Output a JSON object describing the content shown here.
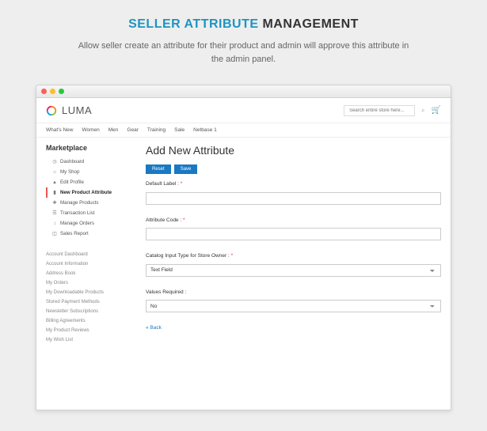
{
  "hero": {
    "title_accent": "SELLER ATTRIBUTE",
    "title_rest": "MANAGEMENT",
    "subtitle": "Allow seller create an attribute for their product and admin will approve this attribute in the admin panel."
  },
  "logo": {
    "text": "LUMA"
  },
  "search": {
    "placeholder": "Search entire store here..."
  },
  "mainnav": [
    "What's New",
    "Women",
    "Men",
    "Gear",
    "Training",
    "Sale",
    "Netbase 1"
  ],
  "sidebar": {
    "title": "Marketplace",
    "items": [
      {
        "icon": "dashboard-icon",
        "glyph": "◷",
        "label": "Dashboard"
      },
      {
        "icon": "home-icon",
        "glyph": "⌂",
        "label": "My Shop"
      },
      {
        "icon": "user-icon",
        "glyph": "▲",
        "label": "Edit Profile"
      },
      {
        "icon": "attribute-icon",
        "glyph": "▮",
        "label": "New Product Attribute",
        "active": true
      },
      {
        "icon": "products-icon",
        "glyph": "✚",
        "label": "Manage Products"
      },
      {
        "icon": "list-icon",
        "glyph": "☰",
        "label": "Transaction List"
      },
      {
        "icon": "orders-icon",
        "glyph": "↕",
        "label": "Manage Orders"
      },
      {
        "icon": "report-icon",
        "glyph": "◫",
        "label": "Sales Report"
      }
    ],
    "account_items": [
      "Account Dashboard",
      "Account Information",
      "Address Book",
      "My Orders",
      "My Downloadable Products",
      "Stored Payment Methods",
      "Newsletter Subscriptions",
      "Billing Agreements",
      "My Product Reviews",
      "My Wish List"
    ]
  },
  "content": {
    "title": "Add New Attribute",
    "buttons": {
      "reset": "Reset",
      "save": "Save"
    },
    "fields": {
      "default_label": {
        "label": "Default Label :",
        "value": ""
      },
      "attribute_code": {
        "label": "Attribute Code :",
        "value": ""
      },
      "input_type": {
        "label": "Catalog Input Type for Store Owner :",
        "value": "Text Field"
      },
      "values_required": {
        "label": "Values Required :",
        "value": "No"
      }
    },
    "back": "« Back"
  }
}
